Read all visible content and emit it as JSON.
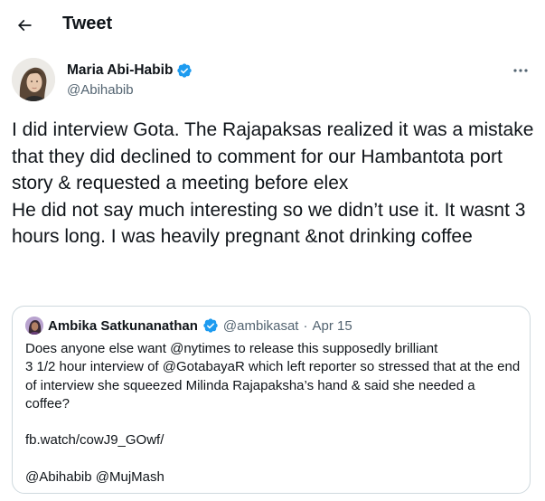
{
  "header": {
    "title": "Tweet",
    "back_icon": "arrow-left-icon"
  },
  "author": {
    "name": "Maria Abi-Habib",
    "handle": "@Abihabib",
    "verified": true,
    "verified_color": "#1d9bf0"
  },
  "tweet": {
    "text": "I did interview Gota. The Rajapaksas realized it was a mistake that they did declined to comment for our Hambantota port story & requested a meeting before elex\nHe did not say much interesting so we didn’t use it. It wasnt 3 hours long. I was heavily pregnant &not drinking coffee"
  },
  "quoted_tweet": {
    "name": "Ambika Satkunanathan",
    "handle": "@ambikasat",
    "separator": "·",
    "date": "Apr 15",
    "verified": true,
    "text": "Does anyone else want @nytimes to release this supposedly brilliant\n3 1/2 hour interview of @GotabayaR which left reporter so stressed that at the end of interview she squeezed Milinda Rajapaksha’s hand & said she needed a coffee?\n\nfb.watch/cowJ9_GOwf/\n\n@Abihabib @MujMash"
  },
  "colors": {
    "text_primary": "#0f1419",
    "text_secondary": "#536471",
    "border": "#cfd9de",
    "accent": "#1d9bf0"
  }
}
